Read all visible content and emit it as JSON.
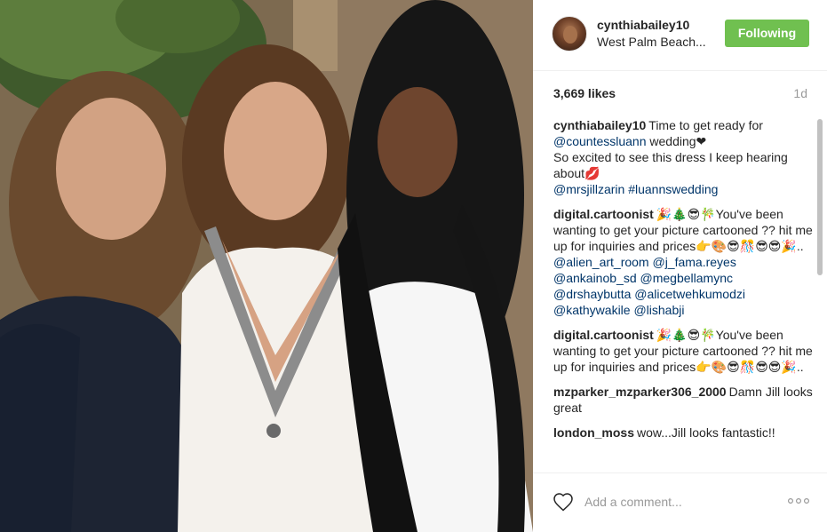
{
  "post": {
    "photo_alt": "",
    "header": {
      "username": "cynthiabailey10",
      "location": "West Palm Beach...",
      "follow_label": "Following",
      "follow_color": "#70c050"
    },
    "likes": "3,669 likes",
    "time_ago": "1d",
    "comments": [
      {
        "author": "cynthiabailey10",
        "text_before": "Time to get ready for ",
        "mention": "@countessluann",
        "text_after": " wedding❤\nSo excited to see this dress I keep hearing about💋",
        "tags": "@mrsjillzarin #luannswedding"
      },
      {
        "author": "digital.cartoonist",
        "text": "🎉🎄😎🎋You've been wanting to get your picture cartooned ?? hit me up for inquiries and prices👉🎨😎🎊😎😎🎉.. ",
        "tags": "@alien_art_room @j_fama.reyes @ankainob_sd @megbellamync @drshaybutta @alicetwehkumodzi @kathywakile @lishabji"
      },
      {
        "author": "digital.cartoonist",
        "text": "🎉🎄😎🎋You've been wanting to get your picture cartooned ?? hit me up for inquiries and prices👉🎨😎🎊😎😎🎉..",
        "tags": ""
      },
      {
        "author": "mzparker_mzparker306_2000",
        "text": "Damn Jill looks great",
        "tags": ""
      },
      {
        "author": "london_moss",
        "text": "wow...Jill looks fantastic!!",
        "tags": ""
      }
    ],
    "footer": {
      "comment_placeholder": "Add a comment...",
      "like_icon": "heart-outline-icon",
      "more_icon": "more-options-icon"
    }
  }
}
